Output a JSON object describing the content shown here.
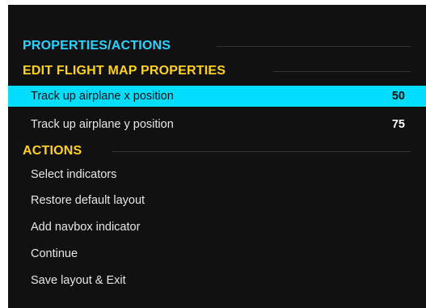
{
  "sections": {
    "properties_actions": "PROPERTIES/ACTIONS",
    "edit_flight_map": "EDIT FLIGHT MAP PROPERTIES",
    "actions": "ACTIONS"
  },
  "properties": [
    {
      "label": "Track up airplane x position",
      "value": "50",
      "selected": true
    },
    {
      "label": "Track up airplane y position",
      "value": "75",
      "selected": false
    }
  ],
  "actions": [
    "Select indicators",
    "Restore default layout",
    "Add navbox indicator",
    "Continue",
    "Save layout & Exit"
  ],
  "colors": {
    "panel_bg": "#111111",
    "header_primary": "#26d4ff",
    "header_secondary": "#ffd21a",
    "selection": "#00ddff"
  }
}
